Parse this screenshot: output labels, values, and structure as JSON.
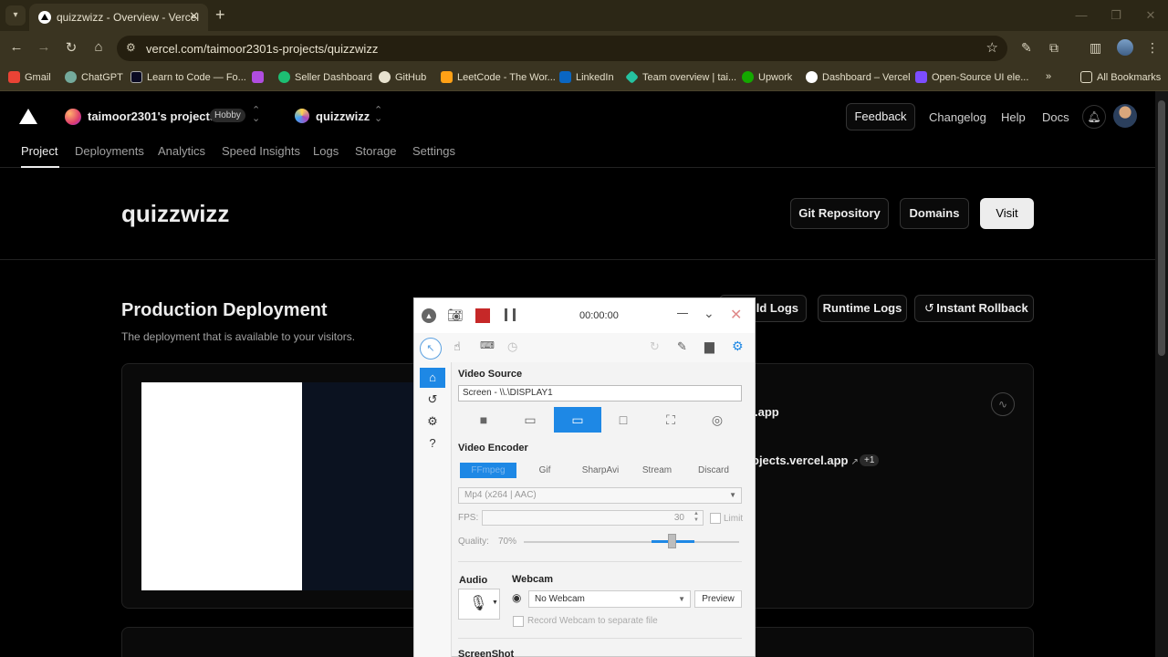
{
  "browser": {
    "tab_title": "quizzwizz - Overview - Vercel",
    "url": "vercel.com/taimoor2301s-projects/quizzwizz",
    "bookmarks": [
      {
        "label": "Gmail",
        "color": "#ea4335"
      },
      {
        "label": "ChatGPT",
        "color": "#74aa9c"
      },
      {
        "label": "Learn to Code — Fo...",
        "color": "#0a0a23"
      },
      {
        "label": "Seller Dashboard",
        "color": "#1dbf73"
      },
      {
        "label": "GitHub",
        "color": "#e8e2cf"
      },
      {
        "label": "LeetCode - The Wor...",
        "color": "#ffa116"
      },
      {
        "label": "LinkedIn",
        "color": "#0a66c2"
      },
      {
        "label": "Team overview | tai...",
        "color": "#25c2a0"
      },
      {
        "label": "Upwork",
        "color": "#14a800"
      },
      {
        "label": "Dashboard – Vercel",
        "color": "#ffffff"
      },
      {
        "label": "Open-Source UI ele...",
        "color": "#7c4dff"
      }
    ],
    "all_bookmarks": "All Bookmarks"
  },
  "vercel": {
    "team_name": "taimoor2301's projects",
    "plan_badge": "Hobby",
    "project_name": "quizzwizz",
    "header_links": {
      "feedback": "Feedback",
      "changelog": "Changelog",
      "help": "Help",
      "docs": "Docs"
    },
    "tabs": [
      "Project",
      "Deployments",
      "Analytics",
      "Speed Insights",
      "Logs",
      "Storage",
      "Settings"
    ],
    "hero_title": "quizzwizz",
    "hero_buttons": {
      "git": "Git Repository",
      "domains": "Domains",
      "visit": "Visit"
    },
    "section_title": "Production Deployment",
    "section_subtitle": "The deployment that is available to your visitors.",
    "section_buttons": {
      "build_logs": "uild Logs",
      "runtime_logs": "Runtime Logs",
      "rollback": "Instant Rollback"
    },
    "card_domain_1": ".app",
    "card_domain_2": "ojects.vercel.app",
    "card_more_badge": "+1"
  },
  "recorder": {
    "timer": "00:00:00",
    "video_source_label": "Video Source",
    "video_source_value": "Screen  -  \\\\.\\DISPLAY1",
    "video_encoder_label": "Video Encoder",
    "encoder_tabs": [
      "FFmpeg",
      "Gif",
      "SharpAvi",
      "Stream",
      "Discard"
    ],
    "codec_value": "Mp4 (x264 | AAC)",
    "fps_label": "FPS:",
    "fps_value": "30",
    "limit_label": "Limit",
    "quality_label": "Quality:",
    "quality_value": "70%",
    "quality_percent": 70,
    "audio_label": "Audio",
    "webcam_label": "Webcam",
    "webcam_value": "No Webcam",
    "preview_label": "Preview",
    "record_webcam_label": "Record Webcam to separate file",
    "screenshot_label": "ScreenShot"
  }
}
